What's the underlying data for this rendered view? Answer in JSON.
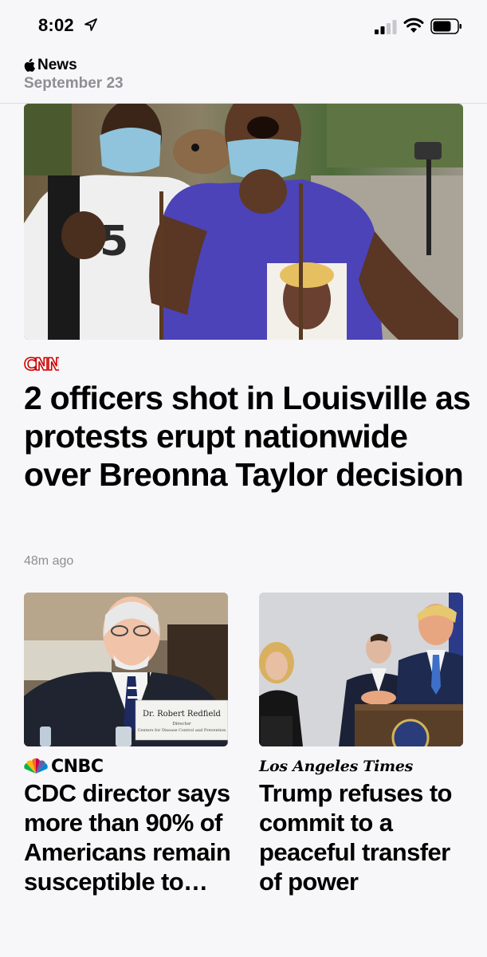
{
  "status_bar": {
    "time": "8:02",
    "icons": [
      "location-arrow-icon",
      "cellular-signal-icon",
      "wifi-icon",
      "battery-icon"
    ]
  },
  "header": {
    "app_name": "News",
    "date": "September 23"
  },
  "hero": {
    "source": "CNN",
    "headline": "2 officers shot in Louisville as protests erupt nationwide over Breonna Taylor decision",
    "time": "48m ago"
  },
  "cards": [
    {
      "source": "CNBC",
      "headline": "CDC director says more than 90% of Americans remain susceptible to…",
      "image_caption": {
        "name": "Dr. Robert Redfield",
        "role": "Director",
        "org": "Centers for Disease Control and Prevention"
      }
    },
    {
      "source": "Los Angeles Times",
      "headline": "Trump refuses to commit to a peaceful transfer of power"
    }
  ],
  "colors": {
    "background": "#f7f7f9",
    "secondary_text": "#8e8e93",
    "cnn_red": "#cc0000"
  }
}
